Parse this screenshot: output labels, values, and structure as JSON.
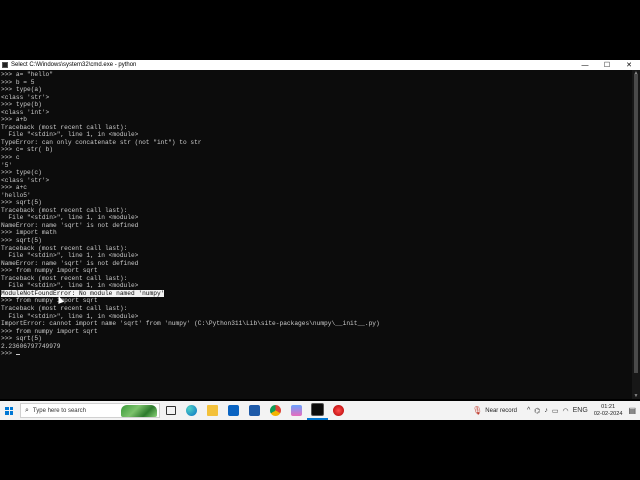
{
  "window": {
    "title": "Select C:\\Windows\\system32\\cmd.exe - python",
    "controls": {
      "minimize": "—",
      "maximize": "☐",
      "close": "✕"
    }
  },
  "console": {
    "lines": [
      ">>> a= \"hello\"",
      ">>> b = 5",
      ">>> type(a)",
      "<class 'str'>",
      ">>> type(b)",
      "<class 'int'>",
      ">>> a+b",
      "Traceback (most recent call last):",
      "  File \"<stdin>\", line 1, in <module>",
      "TypeError: can only concatenate str (not \"int\") to str",
      ">>> c= str( b)",
      ">>> c",
      "'5'",
      ">>> type(c)",
      "<class 'str'>",
      ">>> a+c",
      "'hello5'",
      ">>> sqrt(5)",
      "Traceback (most recent call last):",
      "  File \"<stdin>\", line 1, in <module>",
      "NameError: name 'sqrt' is not defined",
      ">>> import math",
      ">>> sqrt(5)",
      "Traceback (most recent call last):",
      "  File \"<stdin>\", line 1, in <module>",
      "NameError: name 'sqrt' is not defined",
      ">>> from numpy import sqrt",
      "Traceback (most recent call last):",
      "  File \"<stdin>\", line 1, in <module>",
      "ModuleNotFoundError: No module named 'numpy'",
      ">>> from numpy import sqrt",
      "Traceback (most recent call last):",
      "  File \"<stdin>\", line 1, in <module>",
      "ImportError: cannot import name 'sqrt' from 'numpy' (C:\\Python311\\Lib\\site-packages\\numpy\\__init__.py)",
      ">>> from numpy import sqrt",
      ">>> sqrt(5)",
      "2.23606797749979",
      ">>> "
    ],
    "highlighted_line_index": 29
  },
  "taskbar": {
    "search_placeholder": "Type here to search",
    "pinned": [
      {
        "name": "task-view-icon"
      },
      {
        "name": "edge-icon"
      },
      {
        "name": "file-explorer-icon"
      },
      {
        "name": "mail-icon"
      },
      {
        "name": "store-icon"
      },
      {
        "name": "chrome-icon"
      },
      {
        "name": "app-icon"
      },
      {
        "name": "cmd-icon"
      },
      {
        "name": "recorder-icon"
      }
    ],
    "near_record_label": "Near record",
    "language": "ENG",
    "time": "01:21",
    "date": "02-02-2024"
  },
  "colors": {
    "console_bg": "#0c0c0c",
    "console_text": "#cccccc",
    "selection_bg": "#f2f2f2",
    "taskbar_bg": "#f3f3f3",
    "accent": "#0078d4"
  }
}
